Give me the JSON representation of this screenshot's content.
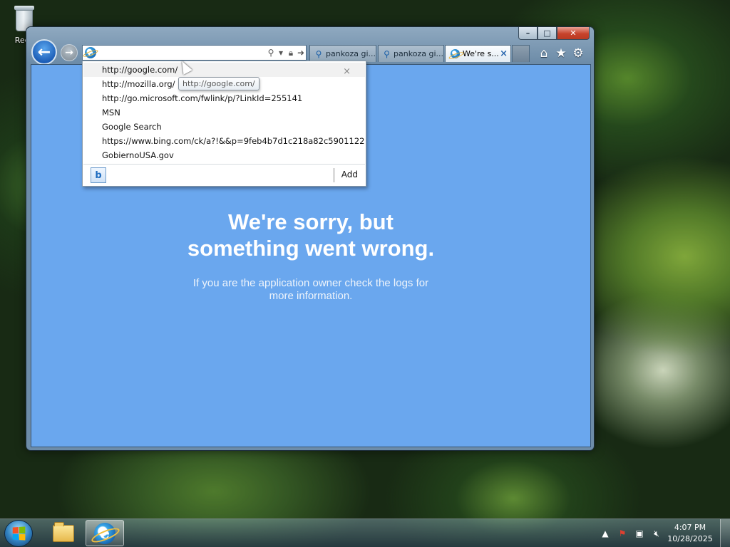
{
  "desktop": {
    "recycle_bin_label": "Recy"
  },
  "browser": {
    "address": {
      "value": "",
      "search_icon": "search-icon",
      "dropdown_icon": "chevron-down-icon",
      "lock_icon": "lock-icon",
      "go_icon": "arrow-right-icon"
    },
    "tabs": [
      {
        "label": "pankoza gi...",
        "icon": "search-icon",
        "active": false
      },
      {
        "label": "pankoza gi...",
        "icon": "search-icon",
        "active": false
      },
      {
        "label": "We're s...",
        "icon": "ie-icon",
        "active": true,
        "close": "×"
      }
    ],
    "command_icons": [
      "home-icon",
      "favorites-star-icon",
      "settings-gear-icon"
    ],
    "caption_buttons": {
      "minimize": "–",
      "maximize": "□",
      "close": "✕"
    },
    "page": {
      "title_line1": "We're sorry, but",
      "title_line2": "something went wrong.",
      "message_line1": "If you are the application owner check the logs for",
      "message_line2": "more information.",
      "background_color": "#6aa7ee"
    }
  },
  "autocomplete": {
    "items": [
      {
        "text": "http://google.com/",
        "hovered": true
      },
      {
        "text": "http://mozilla.org/",
        "hovered": false
      },
      {
        "text": "http://go.microsoft.com/fwlink/p/?LinkId=255141",
        "hovered": false
      },
      {
        "text": "MSN",
        "hovered": false
      },
      {
        "text": "Google Search",
        "hovered": false
      },
      {
        "text": "https://www.bing.com/ck/a?!&&p=9feb4b7d1c218a82c5901122...",
        "hovered": false
      },
      {
        "text": "GobiernoUSA.gov",
        "hovered": false
      }
    ],
    "delete_glyph": "×",
    "tooltip": "http://google.com/",
    "footer": {
      "provider_icon": "bing-icon",
      "provider_glyph": "b",
      "add_label": "Add"
    }
  },
  "taskbar": {
    "pinned": [
      {
        "name": "windows-explorer-icon",
        "active": false
      },
      {
        "name": "internet-explorer-icon",
        "active": true
      }
    ],
    "tray": {
      "icons": [
        "show-hidden-icons-arrow",
        "action-center-flag-icon",
        "network-icon",
        "volume-muted-icon"
      ],
      "time": "4:07 PM",
      "date": "10/28/2025"
    }
  }
}
